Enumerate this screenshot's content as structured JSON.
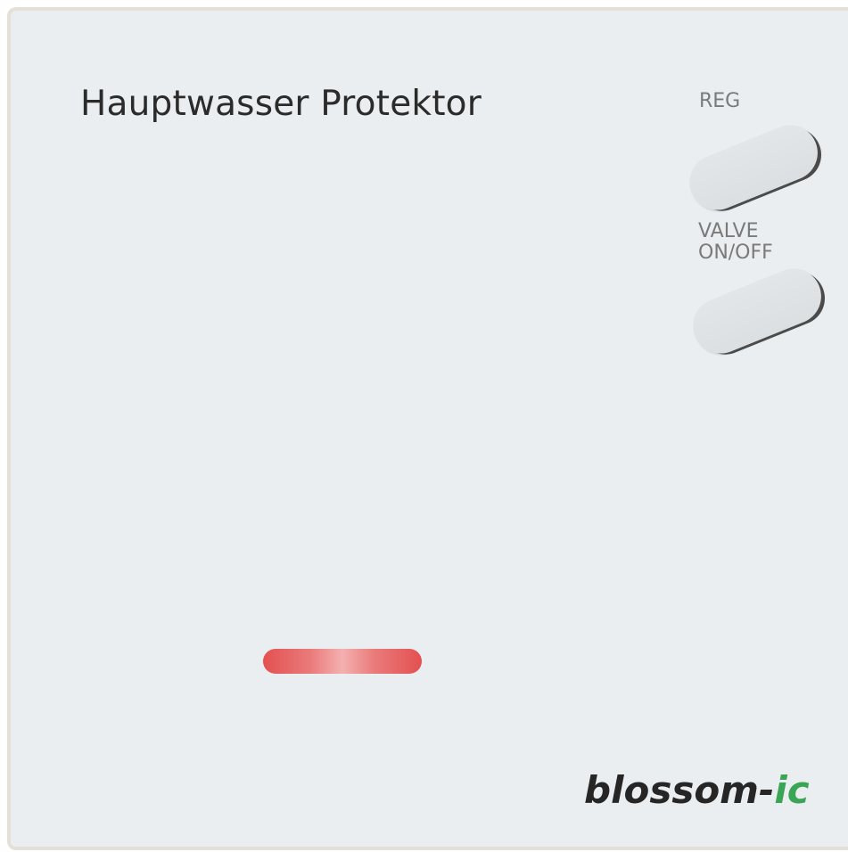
{
  "device": {
    "title": "Hauptwasser Protektor",
    "buttons": {
      "reg_label": "REG",
      "valve_label_line1": "VALVE",
      "valve_label_line2": "ON/OFF"
    },
    "status_led": {
      "color": "#e35050"
    },
    "brand": {
      "prefix": "blossom-",
      "suffix": "ic",
      "suffix_color": "#3aa655"
    }
  }
}
